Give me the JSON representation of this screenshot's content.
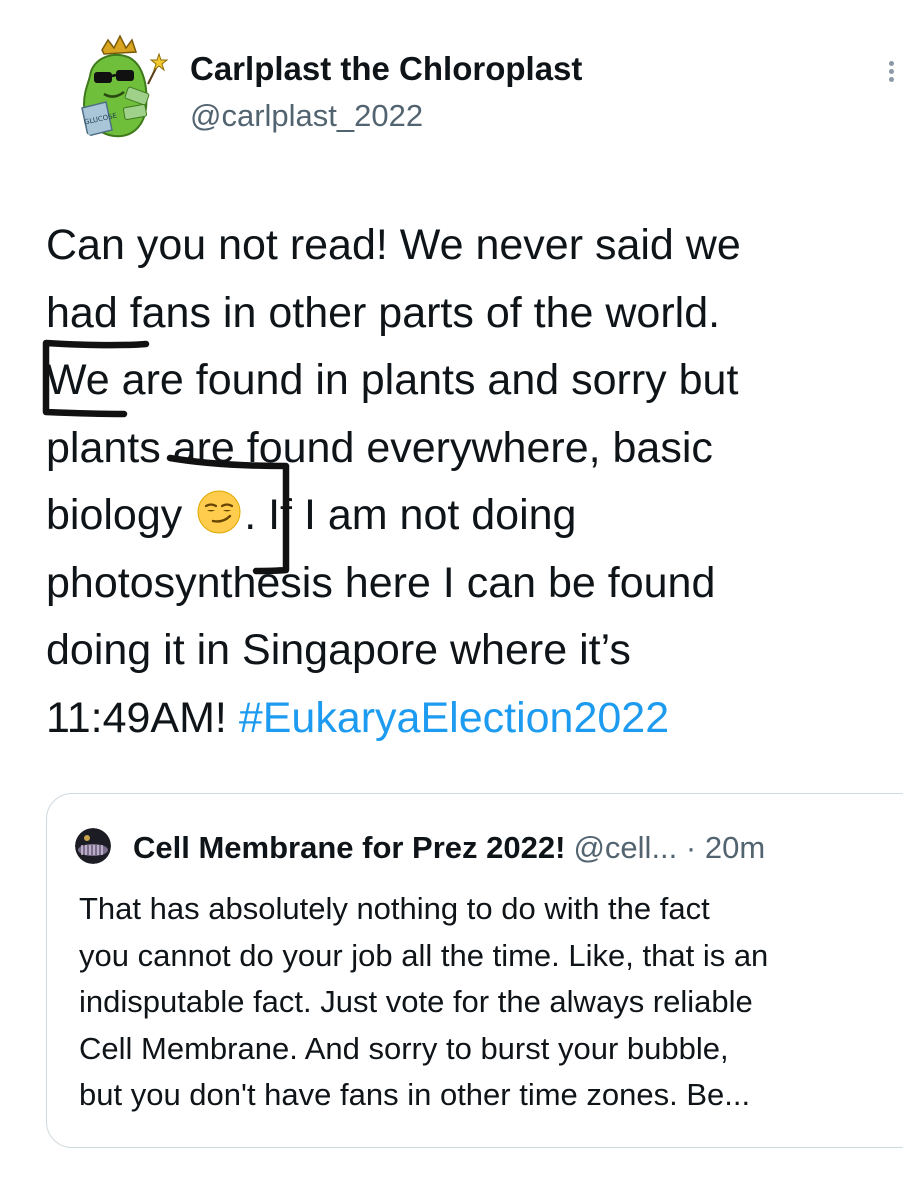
{
  "author": {
    "display_name": "Carlplast the Chloroplast",
    "handle": "@carlplast_2022",
    "avatar_badge_text": "GLUCOSE"
  },
  "tweet": {
    "lines": [
      "Can you not read! We never said we",
      "had fans in other parts of the world.",
      "We are found in plants and sorry but",
      "plants are found everywhere, basic"
    ],
    "line5_before_emoji": "biology ",
    "emoji": "smirking-face",
    "line5_after_emoji": ". If I am not doing",
    "line6": "photosynthesis here I can be found",
    "line7": "doing it in Singapore where it’s",
    "line8_text": "11:49AM! ",
    "hashtag": "#EukaryaElection2022"
  },
  "quoted_tweet": {
    "display_name": "Cell Membrane for Prez 2022!",
    "handle": "@cell...",
    "separator": "·",
    "timestamp": "20m",
    "lines": [
      "That has absolutely nothing to do with the fact",
      "you cannot do your job all the time. Like, that is an",
      "indisputable fact. Just vote for the always reliable",
      "Cell Membrane. And sorry to burst your bubble,",
      "but you don't have fans in other time zones. Be..."
    ]
  },
  "colors": {
    "text": "#0f1419",
    "secondary_text": "#536471",
    "link": "#1d9bf0",
    "border": "#cfd9de",
    "annotation_ink": "#111111"
  }
}
